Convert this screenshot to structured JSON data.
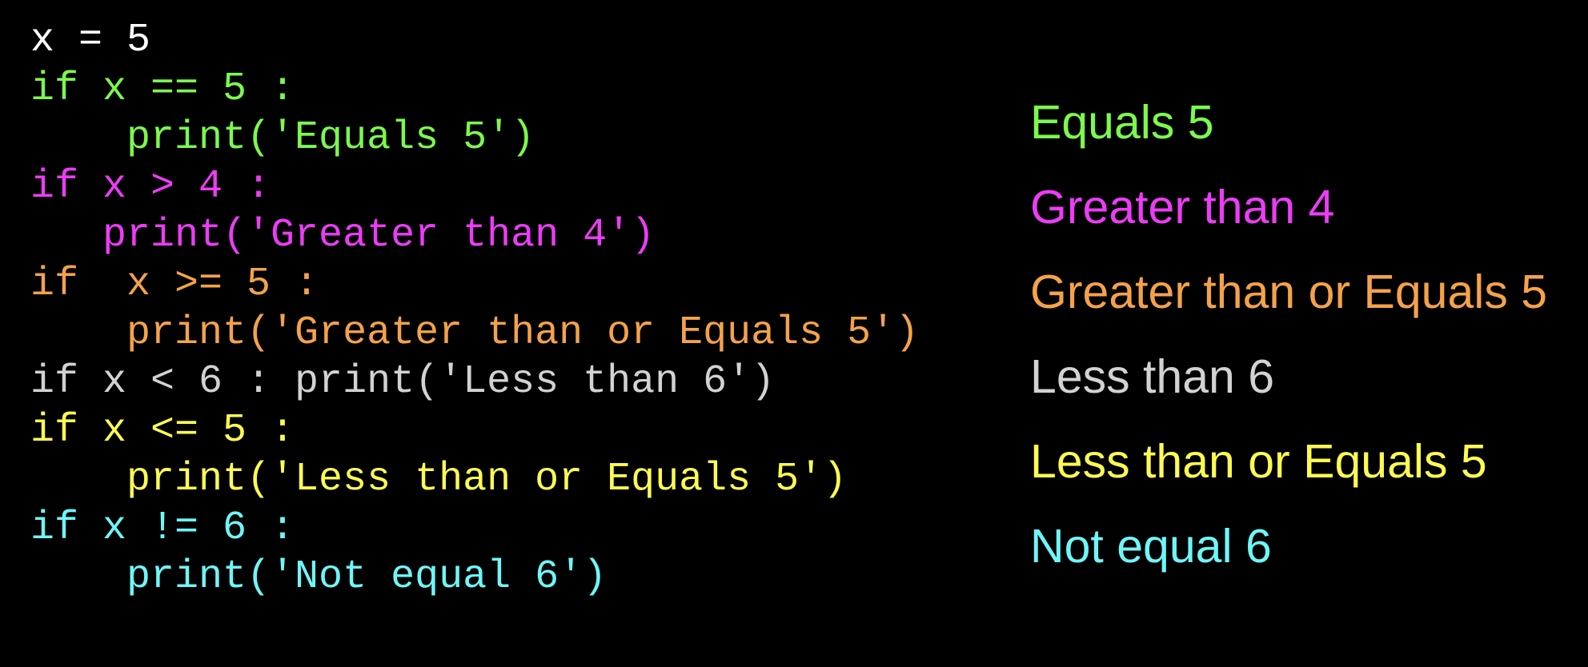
{
  "colors": {
    "background": "#000000",
    "white": "#ffffff",
    "green": "#7bfa4c",
    "magenta": "#ec3cf5",
    "orange": "#f4a24a",
    "gray": "#d2d2d2",
    "yellow": "#fbfb51",
    "cyan": "#6ff6f7"
  },
  "code": {
    "lines": [
      "x = 5",
      "if x == 5 :",
      "    print('Equals 5')",
      "if x > 4 :",
      "   print('Greater than 4')",
      "if  x >= 5 :",
      "    print('Greater than or Equals 5')",
      "if x < 6 : print('Less than 6')",
      "if x <= 5 :",
      "    print('Less than or Equals 5')",
      "if x != 6 :",
      "    print('Not equal 6')"
    ]
  },
  "output": {
    "lines": [
      "Equals 5",
      "Greater than 4",
      "Greater than or Equals 5",
      "Less than 6",
      "Less than or Equals 5",
      "Not equal 6"
    ]
  }
}
